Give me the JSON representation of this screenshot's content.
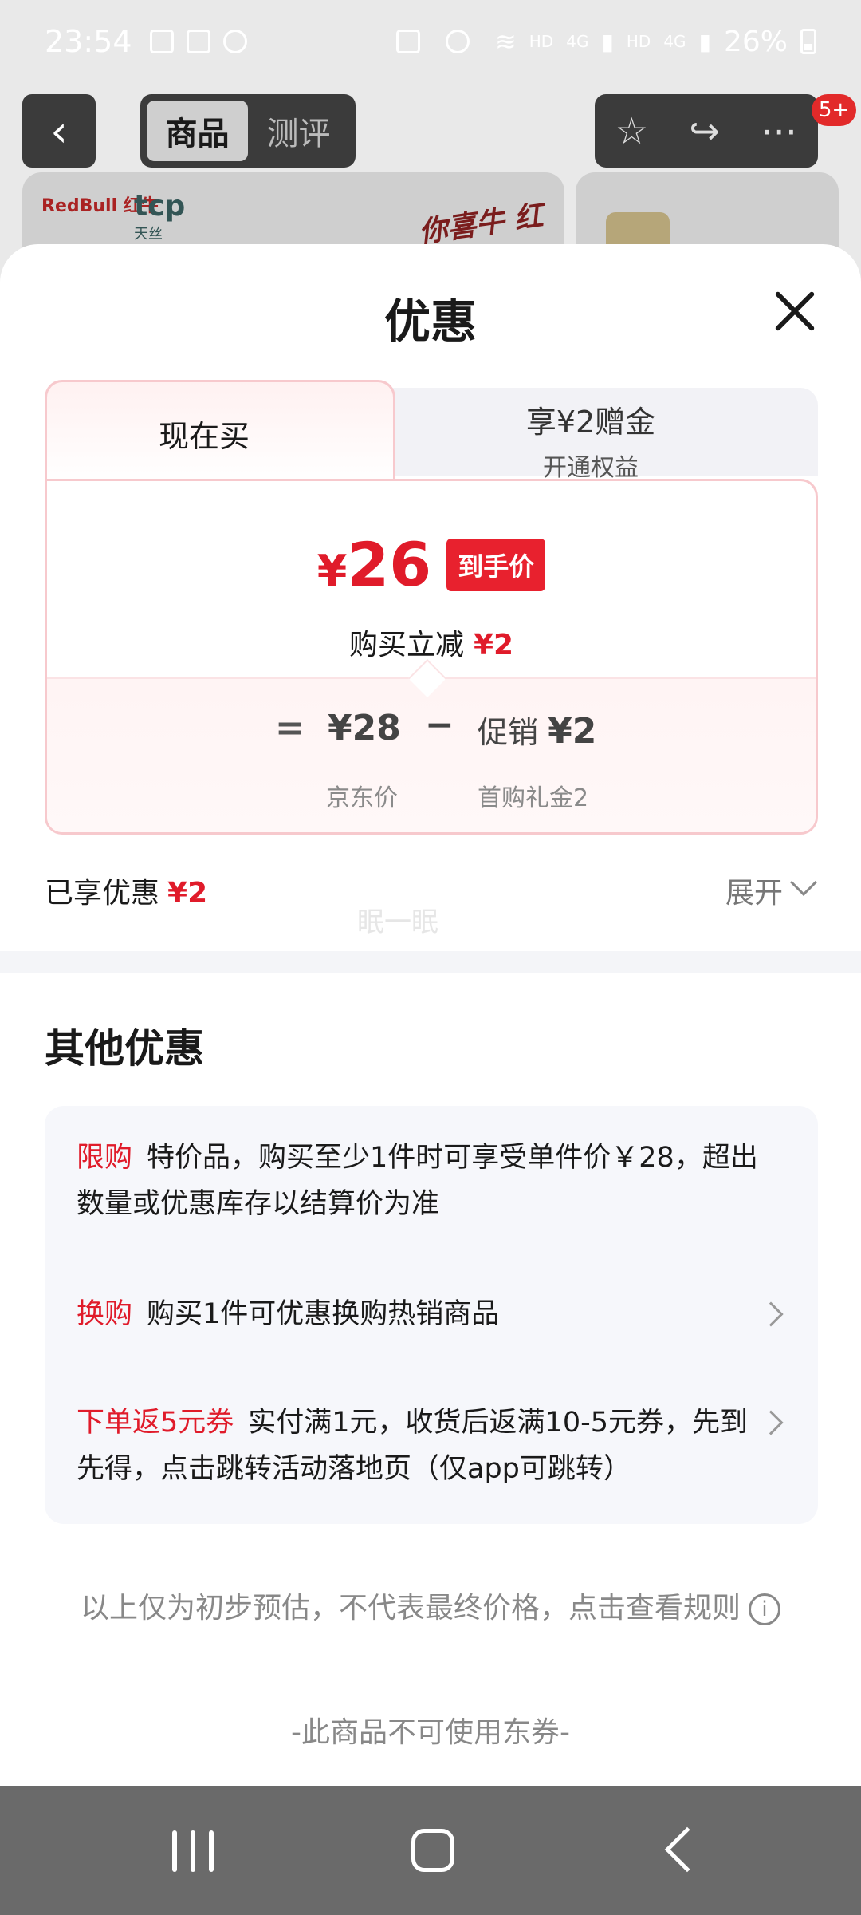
{
  "status_bar": {
    "time": "23:54",
    "network": "HD",
    "signal_label": "4G",
    "battery": "26%"
  },
  "top_nav": {
    "tabs": [
      "商品",
      "测评"
    ],
    "badge": "5+"
  },
  "banner": {
    "brand1": "RedBull 红牛",
    "brand2": "tcp",
    "brand2_sub": "天丝",
    "slogan": "你喜牛 红牛挺你"
  },
  "sheet": {
    "title": "优惠",
    "tab_now": "现在买",
    "tab_other_title": "享¥2赠金",
    "tab_other_sub": "开通权益",
    "final_price": "26",
    "final_price_currency": "¥",
    "final_price_tag": "到手价",
    "reduce_label": "购买立减",
    "reduce_amount": "¥2",
    "calc_equals": "=",
    "calc_base": "¥28",
    "calc_minus": "−",
    "calc_promo_label": "促销",
    "calc_promo_amount": "¥2",
    "calc_base_label": "京东价",
    "calc_promo_sub": "首购礼金2",
    "enjoyed_label": "已享优惠",
    "enjoyed_amount": "¥2",
    "expand_label": "展开",
    "watermark": "眠一眠",
    "other_title": "其他优惠",
    "offers": [
      {
        "keyword": "限购",
        "text": "特价品，购买至少1件时可享受单件价￥28，超出数量或优惠库存以结算价为准"
      },
      {
        "keyword": "换购",
        "text": "购买1件可优惠换购热销商品"
      },
      {
        "keyword": "下单返5元券",
        "text": "实付满1元，收货后返满10-5元券，先到先得，点击跳转活动落地页（仅app可跳转）"
      }
    ],
    "disclaimer": "以上仅为初步预估，不代表最终价格，点击查看规则",
    "note": "-此商品不可使用东券-"
  },
  "colors": {
    "accent": "#e01b2a",
    "card_border": "#f7c9cd",
    "muted": "#888888"
  }
}
